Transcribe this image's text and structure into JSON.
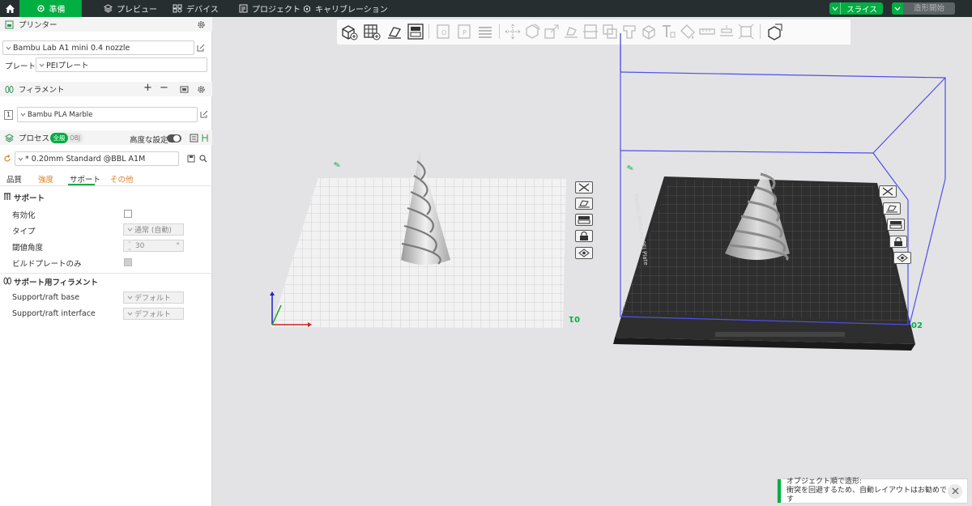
{
  "topbar": {
    "tabs": [
      {
        "label": "準備"
      },
      {
        "label": "プレビュー"
      },
      {
        "label": "デバイス"
      },
      {
        "label": "プロジェクト"
      },
      {
        "label": "キャリブレーション"
      }
    ],
    "slice_label": "スライス",
    "print_label": "造形開始"
  },
  "printer": {
    "title": "プリンター",
    "selected": "Bambu Lab A1 mini 0.4 nozzle",
    "plate_label": "プレート",
    "plate_value": "PEIプレート"
  },
  "filament": {
    "title": "フィラメント",
    "items": [
      {
        "index": "1",
        "name": "Bambu PLA Marble"
      }
    ]
  },
  "process": {
    "title": "プロセス",
    "toggle_global": "全般",
    "toggle_obj": "OBJ",
    "advanced_label": "高度な設定",
    "preset": "* 0.20mm Standard @BBL A1M",
    "tabs": [
      {
        "label": "品質"
      },
      {
        "label": "強度"
      },
      {
        "label": "サポート"
      },
      {
        "label": "その他"
      }
    ],
    "support_section": "サポート",
    "rows": [
      {
        "label": "有効化"
      },
      {
        "label": "タイプ",
        "value": "通常 (自動)"
      },
      {
        "label": "閾値角度",
        "value": "30",
        "unit": "°"
      },
      {
        "label": "ビルドプレートのみ"
      }
    ],
    "filament_section": "サポート用フィラメント",
    "filament_rows": [
      {
        "label": "Support/raft base",
        "value": "デフォルト"
      },
      {
        "label": "Support/raft interface",
        "value": "デフォルト"
      }
    ]
  },
  "viewport": {
    "plate1_label": "01",
    "plate2_label": "02",
    "plate2_text": "Bambu Textured PEI Plate"
  },
  "notification": {
    "line1": "オブジェクト順で造形:",
    "line2": "衝突を回避するため、自動レイアウトはお勧めです"
  },
  "colors": {
    "accent": "#00ae42",
    "topbar": "#262e30"
  }
}
